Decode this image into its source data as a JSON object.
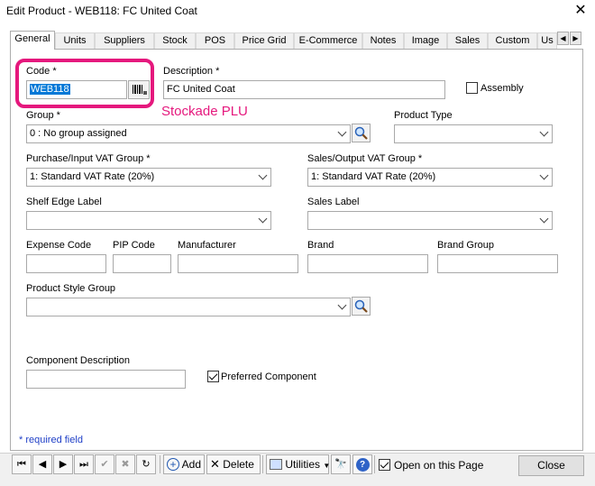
{
  "window": {
    "title": "Edit Product - WEB118: FC United Coat"
  },
  "tabs": [
    {
      "label": "General"
    },
    {
      "label": "Units"
    },
    {
      "label": "Suppliers"
    },
    {
      "label": "Stock"
    },
    {
      "label": "POS"
    },
    {
      "label": "Price Grid"
    },
    {
      "label": "E-Commerce"
    },
    {
      "label": "Notes"
    },
    {
      "label": "Image"
    },
    {
      "label": "Sales"
    },
    {
      "label": "Custom"
    },
    {
      "label": "Us"
    }
  ],
  "form": {
    "code": {
      "label": "Code *",
      "value": "WEB118"
    },
    "description": {
      "label": "Description *",
      "value": "FC United Coat"
    },
    "assembly": {
      "label": "Assembly",
      "checked": false
    },
    "annotation": "Stockade PLU",
    "group": {
      "label": "Group *",
      "value": "0 : No group assigned"
    },
    "product_type": {
      "label": "Product Type",
      "value": ""
    },
    "purchase_vat": {
      "label": "Purchase/Input VAT Group *",
      "value": "1: Standard VAT Rate (20%)"
    },
    "sales_vat": {
      "label": "Sales/Output VAT Group *",
      "value": "1: Standard VAT Rate (20%)"
    },
    "shelf_edge_label": {
      "label": "Shelf Edge Label",
      "value": ""
    },
    "sales_label": {
      "label": "Sales Label",
      "value": ""
    },
    "expense_code": {
      "label": "Expense Code",
      "value": ""
    },
    "pip_code": {
      "label": "PIP Code",
      "value": ""
    },
    "manufacturer": {
      "label": "Manufacturer",
      "value": ""
    },
    "brand": {
      "label": "Brand",
      "value": ""
    },
    "brand_group": {
      "label": "Brand Group",
      "value": ""
    },
    "product_style_group": {
      "label": "Product Style Group",
      "value": ""
    },
    "component_description": {
      "label": "Component Description",
      "value": ""
    },
    "preferred_component": {
      "label": "Preferred Component",
      "checked": true
    },
    "required_note": "* required field"
  },
  "toolbar": {
    "add_label": "Add",
    "delete_label": "Delete",
    "utilities_label": "Utilities",
    "open_on_page_label": "Open on this Page",
    "close_label": "Close"
  },
  "colors": {
    "annotation": "#e5187d",
    "selection": "#0078d7",
    "required_note": "#1f3fc7"
  }
}
